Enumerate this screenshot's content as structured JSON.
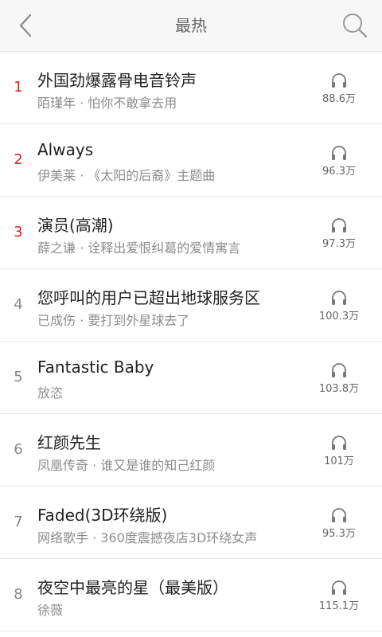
{
  "header": {
    "title": "最热",
    "back_icon": "chevron-left-icon",
    "search_icon": "search-icon"
  },
  "songs": [
    {
      "rank": "1",
      "title": "外国劲爆露骨电音铃声",
      "subtitle": "陌瑾年 · 怕你不敢拿去用",
      "plays": "88.6万"
    },
    {
      "rank": "2",
      "title": "Always",
      "subtitle": "伊美莱 · 《太阳的后裔》主题曲",
      "plays": "96.3万"
    },
    {
      "rank": "3",
      "title": "演员(高潮)",
      "subtitle": "薛之谦 · 诠释出爱恨纠葛的爱情寓言",
      "plays": "97.3万"
    },
    {
      "rank": "4",
      "title": "您呼叫的用户已超出地球服务区",
      "subtitle": "已成伤 · 要打到外星球去了",
      "plays": "100.3万"
    },
    {
      "rank": "5",
      "title": "Fantastic Baby",
      "subtitle": "放恣",
      "plays": "103.8万"
    },
    {
      "rank": "6",
      "title": "红颜先生",
      "subtitle": "凤凰传奇 · 谁又是谁的知己红颜",
      "plays": "101万"
    },
    {
      "rank": "7",
      "title": "Faded(3D环绕版)",
      "subtitle": "网络歌手 · 360度震撼夜店3D环绕女声",
      "plays": "95.3万"
    },
    {
      "rank": "8",
      "title": "夜空中最亮的星（最美版）",
      "subtitle": "徐薇",
      "plays": "115.1万"
    }
  ],
  "colors": {
    "rank_top": "#e02020",
    "rank_normal": "#888888"
  }
}
